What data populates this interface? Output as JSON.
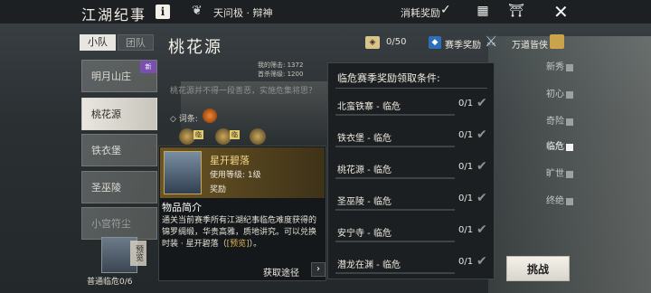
{
  "header": {
    "title": "江湖纪事",
    "info_label": "i",
    "mode_label": "天问极 · 辩神",
    "consume_label": "消耗奖励",
    "consume_checked": "✓"
  },
  "left": {
    "tabs": [
      {
        "label": "小队"
      },
      {
        "label": "团队"
      }
    ],
    "maps": [
      {
        "label": "明月山庄",
        "badge": "新"
      },
      {
        "label": "桃花源"
      },
      {
        "label": "铁衣堡"
      },
      {
        "label": "圣巫陵"
      },
      {
        "label": "小宫符尘"
      }
    ],
    "preview_tag": "预览",
    "normal_count": "普通临危0/6"
  },
  "center": {
    "map_title": "桃花源",
    "best_kill": "我的筛击: 1372",
    "first_kill": "首杀筛级: 1200",
    "description": "桃花源并不得一段善恶，实施危集将思？",
    "affix_label": "◇ 词条:",
    "char_tag": "临"
  },
  "reward_header": {
    "counter": "0/50",
    "season_label": "赛季奖励",
    "reward_all_label": "万道皆侠"
  },
  "conditions": {
    "title": "临危赛季奖励领取条件:",
    "rows": [
      {
        "name": "北蛮铁寨 - 临危",
        "progress": "0/1"
      },
      {
        "name": "铁衣堡 - 临危",
        "progress": "0/1"
      },
      {
        "name": "桃花源 - 临危",
        "progress": "0/1"
      },
      {
        "name": "圣巫陵 - 临危",
        "progress": "0/1"
      },
      {
        "name": "安宁寺 - 临危",
        "progress": "0/1"
      },
      {
        "name": "潜龙在渊 - 临危",
        "progress": "0/1"
      }
    ]
  },
  "tooltip": {
    "item_name": "星开碧落",
    "use_level": "使用等级: 1级",
    "item_type": "奖励",
    "intro_title": "物品简介",
    "desc_main": "通关当前赛季所有江湖纪事临危难度获得的锦罗绸缎，华贵高雅，质地讲究。可以兑换时装 · 星开碧落（",
    "desc_preview": "[预览]",
    "desc_end": "）。",
    "source_label": "获取途径",
    "arrow": "›"
  },
  "difficulty": {
    "items": [
      {
        "label": "新秀"
      },
      {
        "label": "初心"
      },
      {
        "label": "奇险"
      },
      {
        "label": "临危"
      },
      {
        "label": "旷世"
      },
      {
        "label": "终绝"
      }
    ],
    "active_index": 3,
    "challenge_label": "挑战"
  }
}
